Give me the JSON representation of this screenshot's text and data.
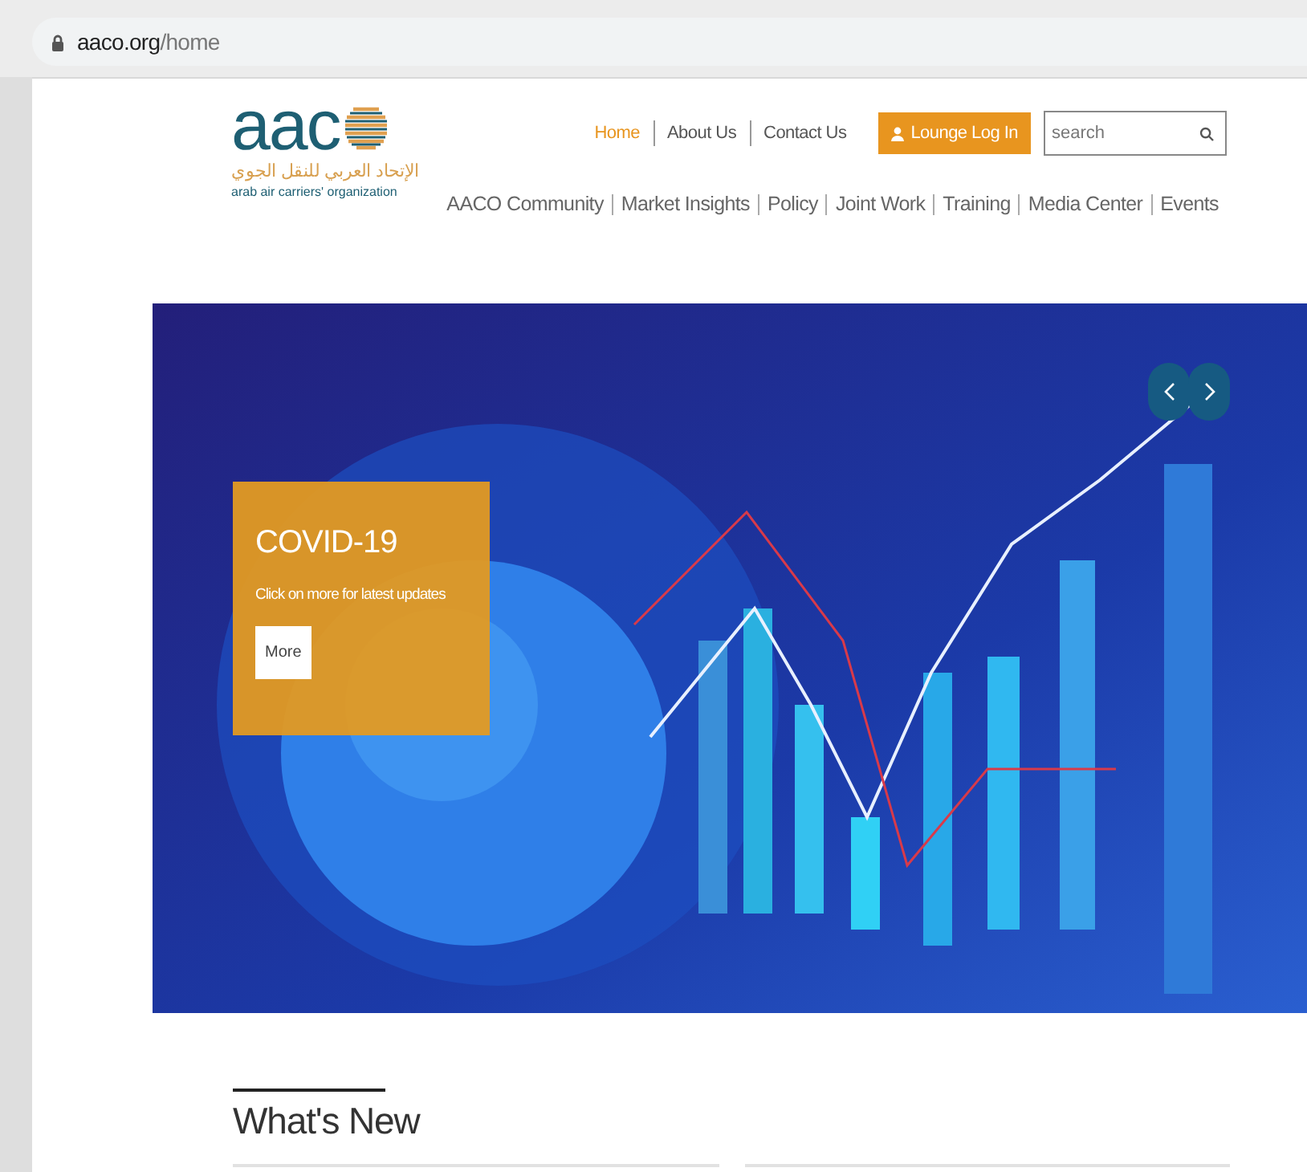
{
  "address_bar": {
    "url": "aaco.org/home"
  },
  "logo": {
    "wordmark": "aac",
    "arabic": "الإتحاد العربي للنقل الجوي",
    "english": "arab air carriers' organization"
  },
  "top_links": [
    {
      "label": "Home",
      "selected": true
    },
    {
      "label": "About Us",
      "selected": false
    },
    {
      "label": "Contact Us",
      "selected": false
    }
  ],
  "login_button": "Lounge Log In",
  "search": {
    "placeholder": "search"
  },
  "main_nav": [
    "AACO Community",
    "Market Insights",
    "Policy",
    "Joint Work",
    "Training",
    "Media Center",
    "Events"
  ],
  "hero": {
    "kind": "picture",
    "card": {
      "title": "COVID-19",
      "text": "Click on more for latest updates",
      "button": "More"
    }
  },
  "whats_new": {
    "heading": "What's New"
  }
}
